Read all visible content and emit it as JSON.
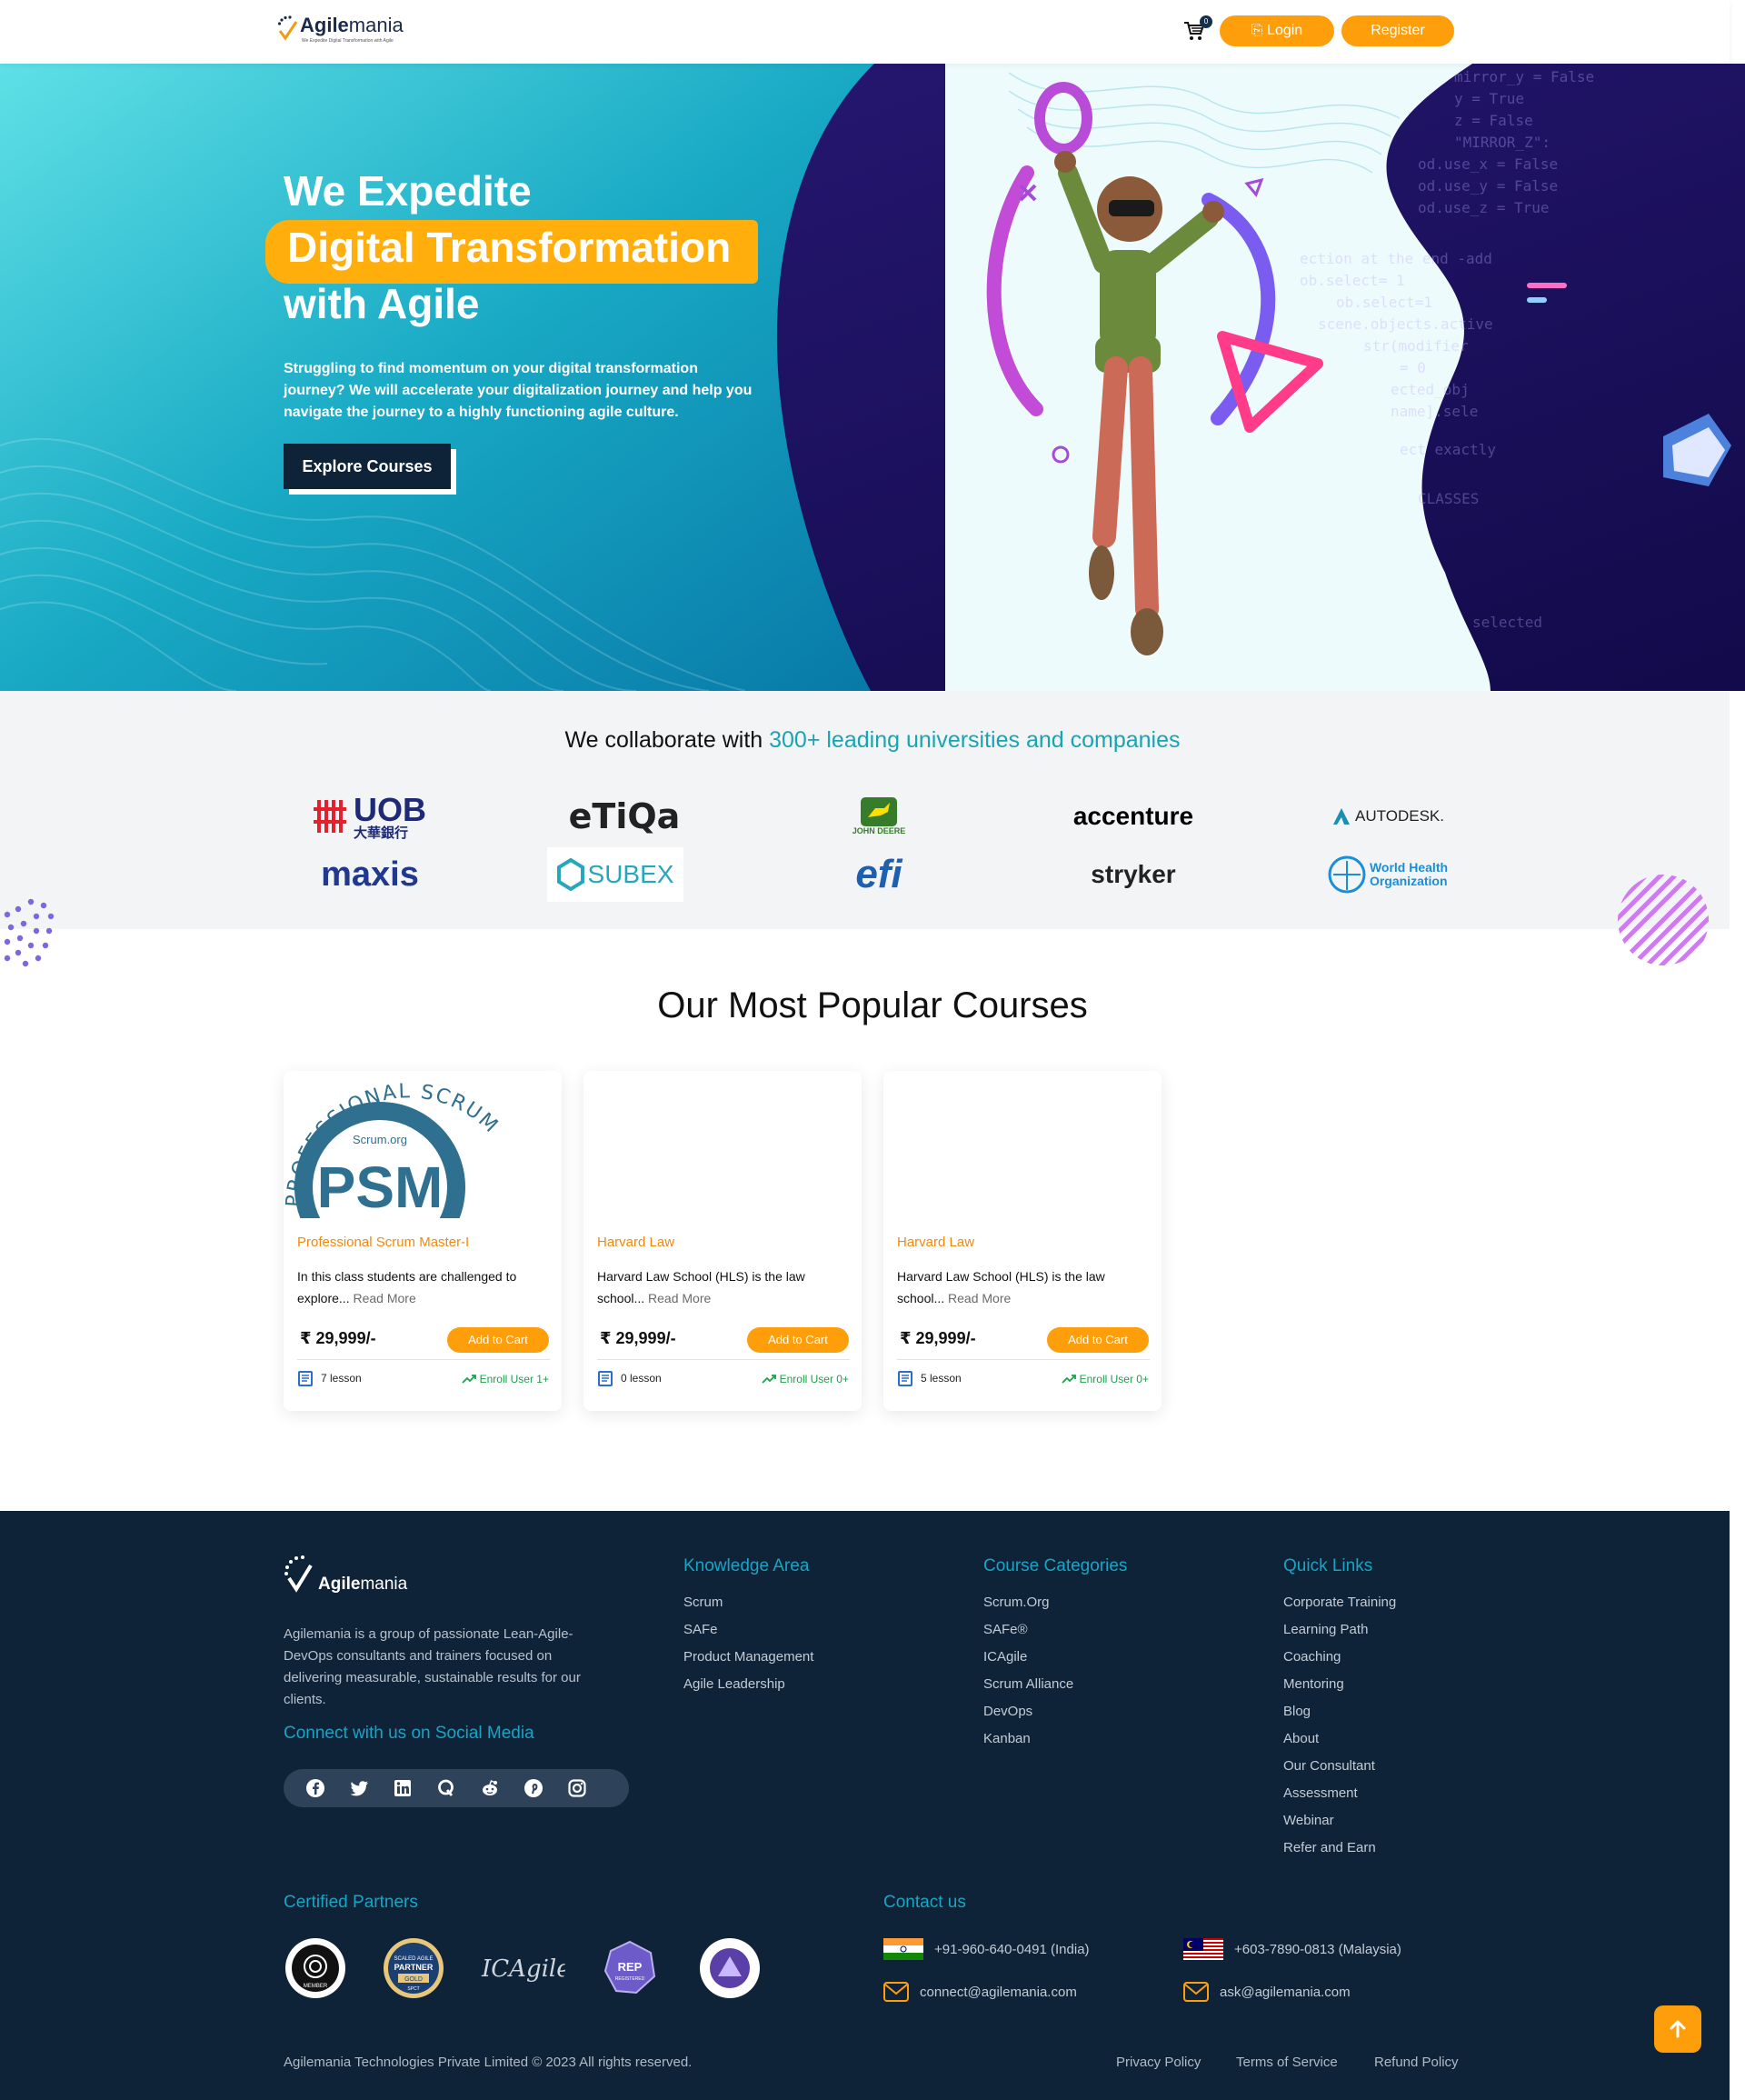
{
  "nav": {
    "logo_bold": "Agile",
    "logo_light": "mania",
    "tagline": "We Expedite Digital Transformation with Agile",
    "cart_count": "0",
    "login_label": "⎘ Login",
    "register_label": "Register"
  },
  "hero": {
    "line1": "We Expedite",
    "line2": "Digital Transformation",
    "line3": "with Agile",
    "paragraph": "Struggling to find momentum on your digital transformation journey? We will accelerate your digitalization journey and help you navigate the journey to a highly functioning agile culture.",
    "cta": "Explore Courses",
    "code_lines": [
      "mirror_y = False",
      "y = True",
      "z = False",
      "\"MIRROR_Z\":",
      "od.use_x = False",
      "od.use_y = False",
      "od.use_z = True",
      "ection at the end -add",
      "ob.select= 1",
      "ob.select=1",
      "scene.objects.active",
      "str(modifier",
      "= 0",
      "ected_obj",
      "name].sele",
      "ect exactly",
      "CLASSES",
      "selected"
    ]
  },
  "collab": {
    "prefix": "We collaborate with ",
    "highlight": "300+ leading universities and companies",
    "logos": {
      "uob": "UOB",
      "uob_sub": "大華銀行",
      "etiqa": "eTiQa",
      "johndeere": "JOHN DEERE",
      "accenture": "accenture",
      "autodesk": "AUTODESK.",
      "maxis": "maxis",
      "subex": "SUBEX",
      "efi": "efi",
      "stryker": "stryker",
      "who_line1": "World Health",
      "who_line2": "Organization"
    }
  },
  "courses": {
    "title": "Our Most Popular Courses",
    "psm_arc": "PROFESSIONAL SCRUM",
    "psm_brand": "Scrum.org",
    "psm_big": "PSM",
    "items": [
      {
        "category": "Professional Scrum Master-I",
        "desc": "In this class students are challenged to explore...",
        "read_more": "Read More",
        "price": "₹ 29,999/-",
        "cart": "Add to Cart",
        "lessons": "7 lesson",
        "enroll": "Enroll User 1+"
      },
      {
        "category": "Harvard Law",
        "desc": "Harvard Law School (HLS) is the law school...",
        "read_more": "Read More",
        "price": "₹ 29,999/-",
        "cart": "Add to Cart",
        "lessons": "0 lesson",
        "enroll": "Enroll User 0+"
      },
      {
        "category": "Harvard Law",
        "desc": "Harvard Law School (HLS) is the law school...",
        "read_more": "Read More",
        "price": "₹ 29,999/-",
        "cart": "Add to Cart",
        "lessons": "5 lesson",
        "enroll": "Enroll User 0+"
      }
    ]
  },
  "footer": {
    "logo_bold": "Agile",
    "logo_light": "mania",
    "about": "Agilemania is a group of passionate Lean-Agile-DevOps consultants and trainers focused on delivering measurable, sustainable results for our clients.",
    "social_title": "Connect with us on Social Media",
    "social_icons": [
      "facebook-icon",
      "twitter-icon",
      "linkedin-icon",
      "quora-icon",
      "reddit-icon",
      "pinterest-icon",
      "instagram-icon"
    ],
    "knowledge": {
      "title": "Knowledge Area",
      "items": [
        "Scrum",
        "SAFe",
        "Product Management",
        "Agile Leadership"
      ]
    },
    "categories": {
      "title": "Course Categories",
      "items": [
        "Scrum.Org",
        "SAFe®",
        "ICAgile",
        "Scrum Alliance",
        "DevOps",
        "Kanban"
      ]
    },
    "quick": {
      "title": "Quick Links",
      "items": [
        "Corporate Training",
        "Learning Path",
        "Coaching",
        "Mentoring",
        "Blog",
        "About",
        "Our Consultant",
        "Assessment",
        "Webinar",
        "Refer and Earn"
      ]
    },
    "cert_title": "Certified Partners",
    "badges": {
      "safe_l1": "SCALED AGILE",
      "safe_l2": "PARTNER",
      "safe_l3": "GOLD",
      "safe_l4": "SPCT",
      "icagile": "ICAgile",
      "rep": "REP",
      "rep_sub": "REGISTERED",
      "pst_sub": "MEMBER"
    },
    "contact_title": "Contact us",
    "phone_india": "+91-960-640-0491 (India)",
    "phone_malaysia": "+603-7890-0813 (Malaysia)",
    "email1": "connect@agilemania.com",
    "email2": "ask@agilemania.com",
    "copyright": "Agilemania Technologies Private Limited © 2023 All rights reserved.",
    "privacy": "Privacy Policy",
    "terms": "Terms of Service",
    "refund": "Refund Policy"
  },
  "colors": {
    "accent": "#ff9e0b",
    "teal": "#19a4b4",
    "navy": "#0f2338"
  }
}
